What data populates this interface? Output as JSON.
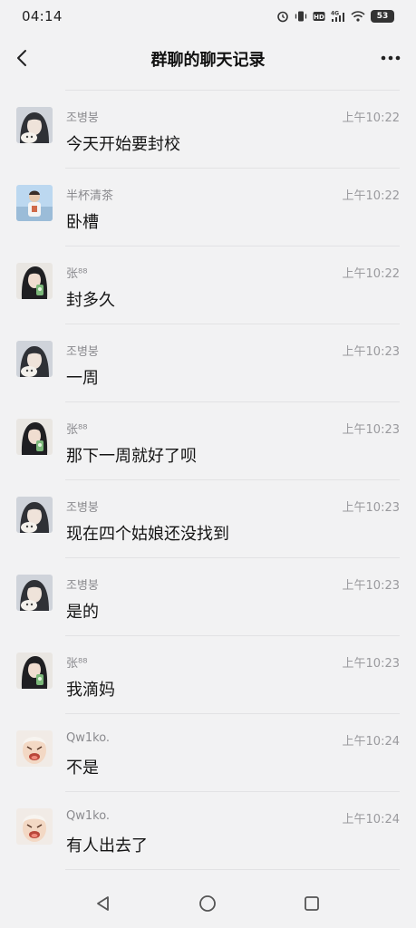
{
  "status_bar": {
    "time": "04:14",
    "network": "4G",
    "battery": "53"
  },
  "header": {
    "title": "群聊的聊天记录"
  },
  "messages": [
    {
      "sender": "조병붕",
      "time": "上午10:22",
      "text": "今天开始要封校",
      "avatar": "avatar-a"
    },
    {
      "sender": "半杯清茶",
      "time": "上午10:22",
      "text": "卧槽",
      "avatar": "avatar-b"
    },
    {
      "sender": "张⁸⁸",
      "time": "上午10:22",
      "text": "封多久",
      "avatar": "avatar-c"
    },
    {
      "sender": "조병붕",
      "time": "上午10:23",
      "text": "一周",
      "avatar": "avatar-a"
    },
    {
      "sender": "张⁸⁸",
      "time": "上午10:23",
      "text": "那下一周就好了呗",
      "avatar": "avatar-c"
    },
    {
      "sender": "조병붕",
      "time": "上午10:23",
      "text": "现在四个姑娘还没找到",
      "avatar": "avatar-a"
    },
    {
      "sender": "조병붕",
      "time": "上午10:23",
      "text": "是的",
      "avatar": "avatar-a"
    },
    {
      "sender": "张⁸⁸",
      "time": "上午10:23",
      "text": "我滴妈",
      "avatar": "avatar-c"
    },
    {
      "sender": "Qw1ko.",
      "time": "上午10:24",
      "text": "不是",
      "avatar": "avatar-d"
    },
    {
      "sender": "Qw1ko.",
      "time": "上午10:24",
      "text": "有人出去了",
      "avatar": "avatar-d"
    }
  ],
  "colors": {
    "background": "#f2f2f3",
    "divider": "#e2e2e4",
    "meta_text": "#8a8a8e"
  }
}
